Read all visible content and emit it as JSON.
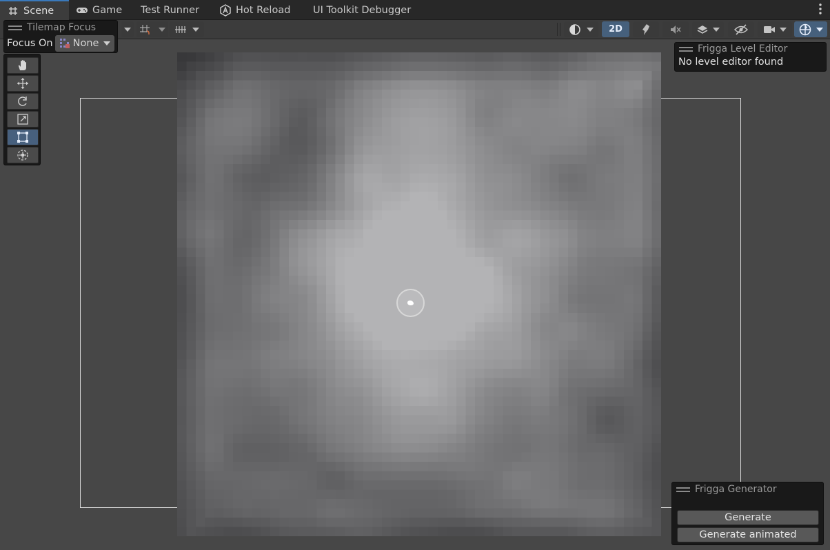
{
  "tabs": [
    {
      "label": "Scene",
      "icon": "grid-icon",
      "active": true
    },
    {
      "label": "Game",
      "icon": "gamepad-icon",
      "active": false
    },
    {
      "label": "Test Runner",
      "icon": "",
      "active": false
    },
    {
      "label": "Hot Reload",
      "icon": "hot-reload-icon",
      "active": false
    },
    {
      "label": "UI Toolkit Debugger",
      "icon": "",
      "active": false
    }
  ],
  "toolbar": {
    "mode_2d_label": "2D"
  },
  "tilemap_focus": {
    "title": "Tilemap Focus",
    "focus_on_label": "Focus On",
    "focus_value": "None"
  },
  "tools": [
    "hand-tool",
    "move-tool",
    "rotate-tool",
    "scale-tool",
    "rect-tool",
    "transform-tool"
  ],
  "selected_tool": "rect-tool",
  "level_editor": {
    "title": "Frigga Level Editor",
    "message": "No level editor found"
  },
  "generator": {
    "title": "Frigga Generator",
    "generate_label": "Generate",
    "generate_animated_label": "Generate animated"
  },
  "colors": {
    "accent": "#3a79bb",
    "selected_tool_bg": "#47607e",
    "scene_bg": "#474747"
  }
}
